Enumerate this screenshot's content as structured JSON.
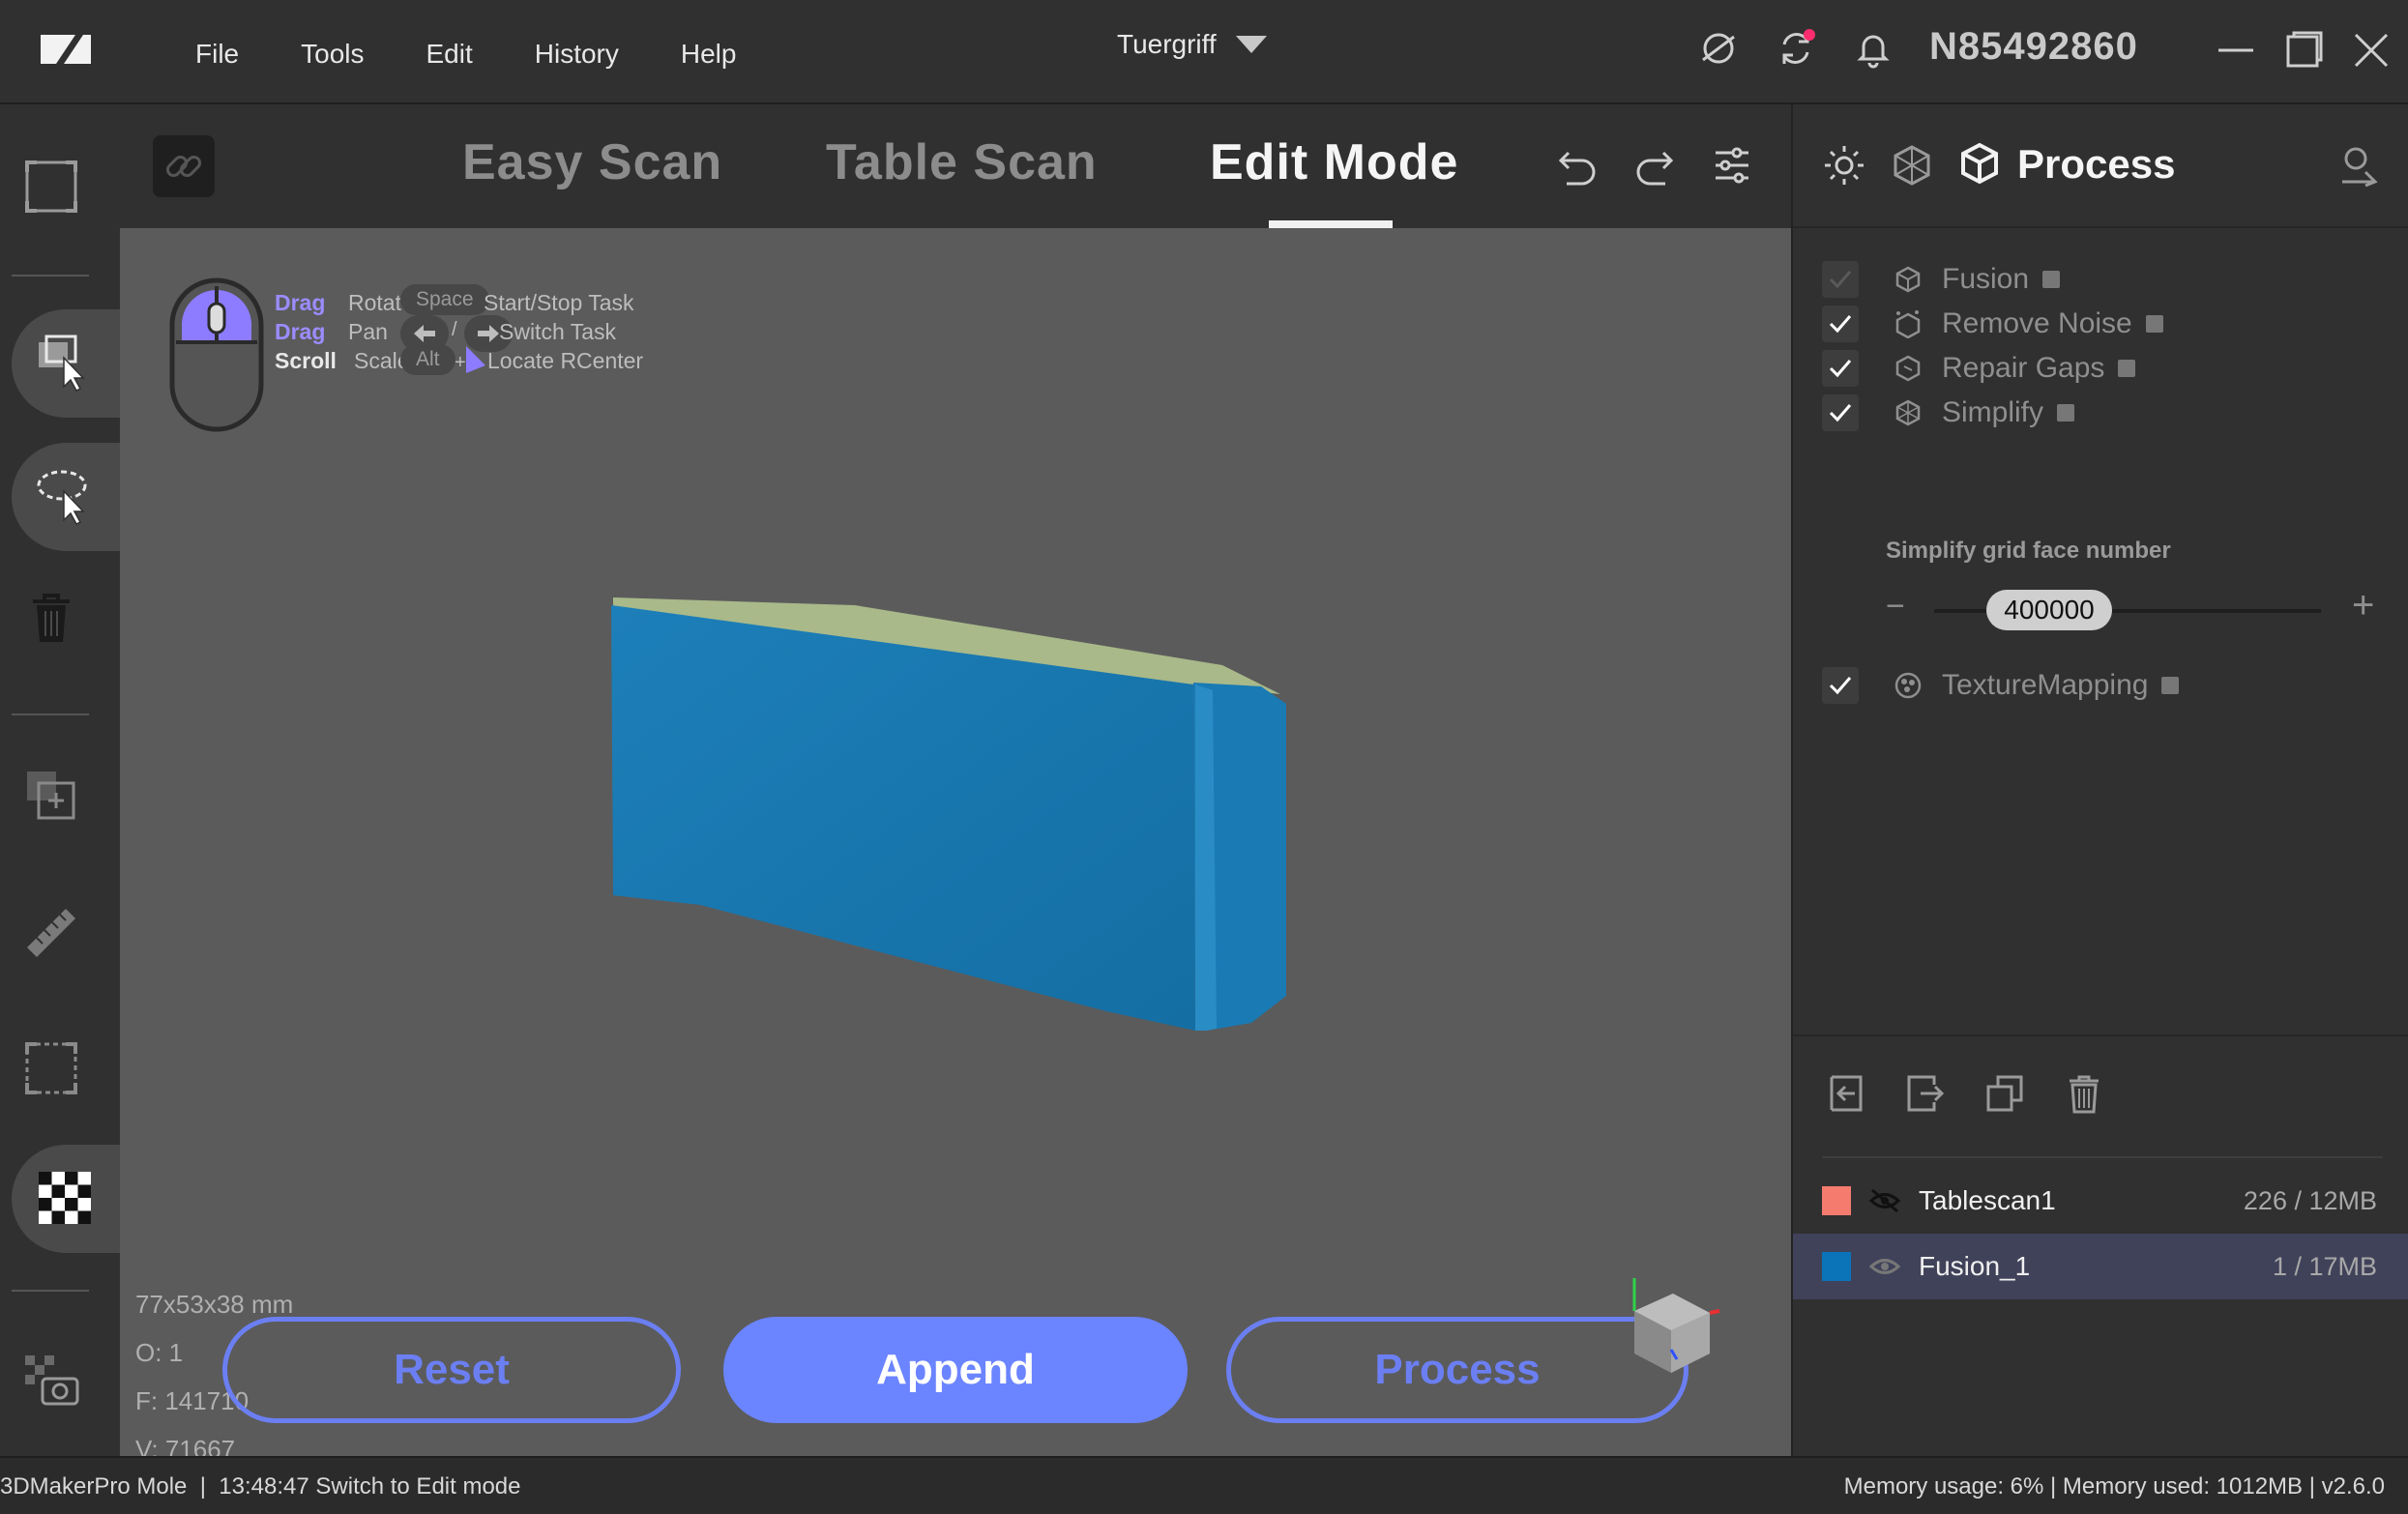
{
  "menu": [
    "File",
    "Tools",
    "Edit",
    "History",
    "Help"
  ],
  "project": {
    "name": "Tuergriff"
  },
  "device_id": "N85492860",
  "tabs": {
    "easy": "Easy Scan",
    "table": "Table Scan",
    "edit": "Edit Mode"
  },
  "hints": {
    "drag1": "Drag",
    "rotate": "Rotate",
    "drag2": "Drag",
    "pan": "Pan",
    "scroll": "Scroll",
    "scale": "Scale",
    "space": "Space",
    "start_stop": "Start/Stop Task",
    "slash": "/",
    "switch_task": "Switch Task",
    "alt": "Alt",
    "plus": "+",
    "locate": "Locate RCenter"
  },
  "model_info": {
    "dims": "77x53x38 mm",
    "o": "O: 1",
    "f": "F: 141710",
    "v": "V: 71667"
  },
  "actions": {
    "reset": "Reset",
    "append": "Append",
    "process": "Process"
  },
  "panel": {
    "title": "Process",
    "steps": [
      {
        "label": "Fusion",
        "checked": true,
        "enabled": false
      },
      {
        "label": "Remove Noise",
        "checked": true,
        "enabled": true
      },
      {
        "label": "Repair Gaps",
        "checked": true,
        "enabled": true
      },
      {
        "label": "Simplify",
        "checked": true,
        "enabled": true
      },
      {
        "label": "TextureMapping",
        "checked": true,
        "enabled": true
      }
    ],
    "simplify_label": "Simplify grid face number",
    "simplify_value": "400000",
    "simplify_minus": "−",
    "simplify_plus": "+"
  },
  "layers": [
    {
      "name": "Tablescan1",
      "size": "226 / 12MB",
      "color": "#f47b6e",
      "visible": false
    },
    {
      "name": "Fusion_1",
      "size": "1 / 17MB",
      "color": "#0b73b8",
      "visible": true
    }
  ],
  "status": {
    "left": "3DMakerPro Mole  |  13:48:47 Switch to Edit mode",
    "right": "Memory usage: 6% | Memory used: 1012MB | v2.6.0"
  },
  "colors": {
    "accent": "#6b84ff",
    "viewport": "#5b5b5b",
    "model": "#1b78b2"
  }
}
